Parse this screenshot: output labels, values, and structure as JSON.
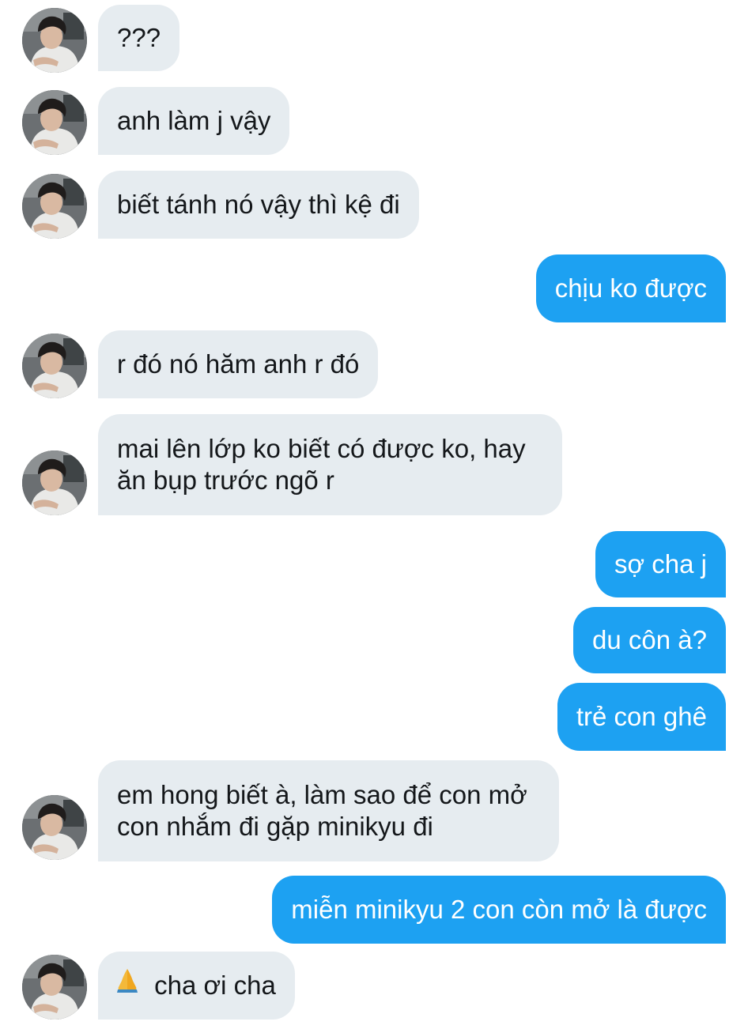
{
  "conversation": {
    "messages": [
      {
        "from": "them",
        "text": "???"
      },
      {
        "from": "them",
        "text": "anh làm j vậy"
      },
      {
        "from": "them",
        "text": "biết tánh nó vậy thì kệ đi"
      },
      {
        "from": "me",
        "text": "chịu ko được"
      },
      {
        "from": "them",
        "text": "r đó nó hăm anh r đó"
      },
      {
        "from": "them",
        "line1": "mai lên lớp ko biết có được ko, hay",
        "line2": "ăn bụp trước ngõ r"
      },
      {
        "from": "me",
        "text": "sợ cha j"
      },
      {
        "from": "me",
        "text": "du côn à?"
      },
      {
        "from": "me",
        "text": "trẻ con ghê"
      },
      {
        "from": "them",
        "line1": "em hong biết à, làm sao để con mở",
        "line2": "con nhắm đi gặp minikyu đi"
      },
      {
        "from": "me",
        "text": "miễn minikyu 2 con còn mở là được"
      },
      {
        "from": "them",
        "emoji": "folded-hands-icon",
        "text": "cha ơi cha"
      }
    ]
  },
  "colors": {
    "incoming_bubble": "#e6ecf0",
    "incoming_text": "#14171a",
    "outgoing_bubble": "#1da1f2",
    "outgoing_text": "#ffffff",
    "background": "#ffffff"
  }
}
